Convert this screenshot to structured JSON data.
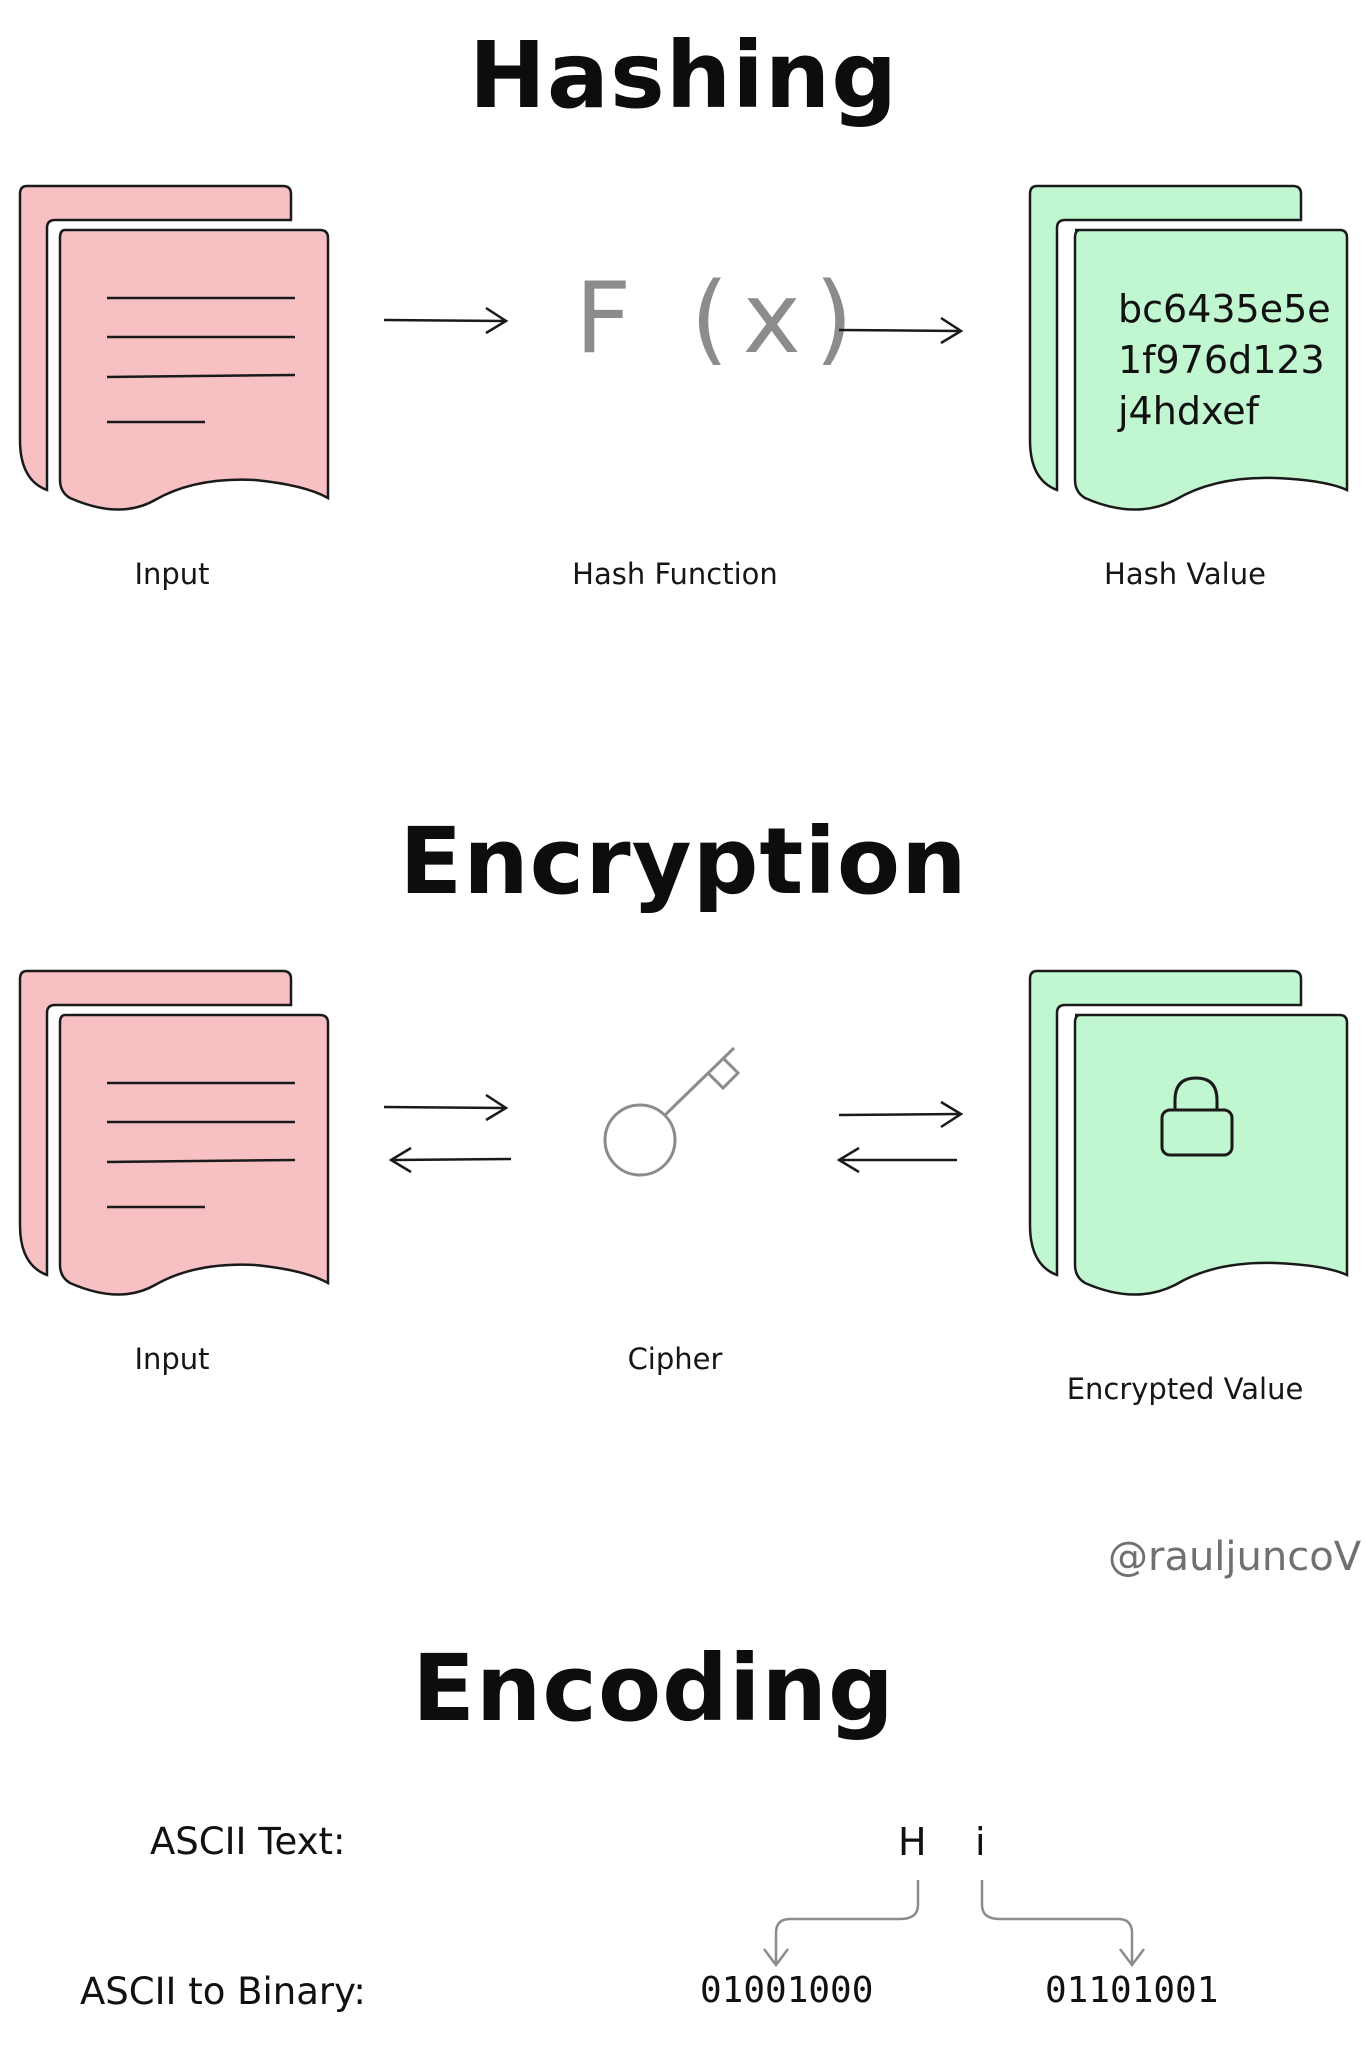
{
  "hashing": {
    "title": "Hashing",
    "input_label": "Input",
    "function_label": "Hash Function",
    "function_symbol": "F (x)",
    "output_label": "Hash Value",
    "hash_lines": [
      "bc6435e5e",
      "1f976d123",
      "j4hdxef"
    ]
  },
  "encryption": {
    "title": "Encryption",
    "input_label": "Input",
    "cipher_label": "Cipher",
    "output_label": "Encrypted Value"
  },
  "watermark": "@rauljuncoV",
  "encoding": {
    "title": "Encoding",
    "ascii_text_label": "ASCII Text:",
    "ascii_binary_label": "ASCII to Binary:",
    "chars": [
      "H",
      "i"
    ],
    "binary": [
      "01001000",
      "01101001"
    ]
  },
  "colors": {
    "input_doc": "#f7c1c4",
    "output_doc": "#c1f7d0",
    "stroke": "#1a1a1a",
    "icon_gray": "#8c8c8c"
  },
  "icons": [
    "document-icon",
    "arrow-right-icon",
    "arrow-left-icon",
    "key-icon",
    "lock-icon"
  ]
}
